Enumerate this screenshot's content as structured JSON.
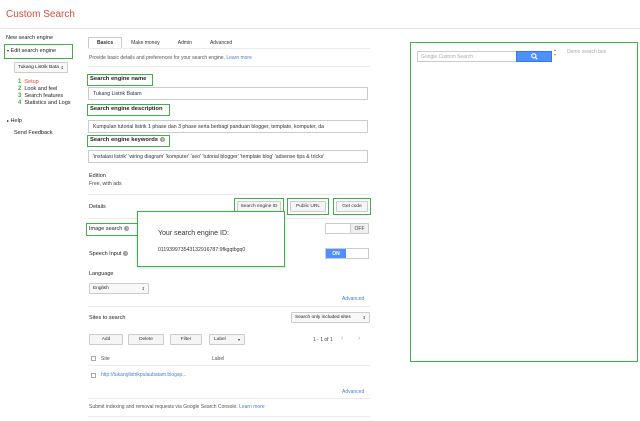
{
  "app": {
    "title": "Custom Search"
  },
  "sidebar": {
    "new_engine": "New search engine",
    "edit_engine": "Edit search engine",
    "engine_select": "Tukang Listrik Bata",
    "steps": [
      {
        "num": "1",
        "label": "Setup"
      },
      {
        "num": "2",
        "label": "Look and feel"
      },
      {
        "num": "3",
        "label": "Search features"
      },
      {
        "num": "4",
        "label": "Statistics and Logs"
      }
    ],
    "help": "Help",
    "feedback": "Send Feedback"
  },
  "tabs": [
    "Basics",
    "Make money",
    "Admin",
    "Advanced"
  ],
  "intro": {
    "text": "Provide basic details and preferences for your search engine.",
    "link": "Learn more"
  },
  "fields": {
    "name_label": "Search engine name",
    "name_value": "Tukang Listrik Batam",
    "desc_label": "Search engine description",
    "desc_value": "Kumpulan tutorial listrik 1 phase dan 3 phase serta berbagi panduan blogger, template, komputer, da",
    "keywords_label": "Search engine keywords",
    "keywords_value": "'instalasi listrik' 'wiring diagram' 'komputer' 'seo' 'tutorial blogger' 'template blog' 'adsense tips & tricks'"
  },
  "edition": {
    "label": "Edition",
    "value": "Free, with ads"
  },
  "details": {
    "label": "Details",
    "engine_id_btn": "Search engine ID",
    "public_url_btn": "Public URL",
    "get_code_btn": "Get code"
  },
  "popup": {
    "title": "Your search engine ID:",
    "id": "011939973543132916787:9fkgqtbgq0"
  },
  "image_search": {
    "label": "Image search",
    "state": "OFF"
  },
  "speech_input": {
    "label": "Speech Input",
    "state": "ON"
  },
  "language": {
    "label": "Language",
    "value": "English"
  },
  "advanced_link": "Advanced",
  "sites": {
    "label": "Sites to search",
    "filter_select": "Search only included sites",
    "add_btn": "Add",
    "delete_btn": "Delete",
    "filter_btn": "Filter",
    "label_btn": "Label",
    "pager": "1 - 1 of 1",
    "col_site": "Site",
    "col_label": "Label",
    "rows": [
      {
        "site": "http://tukanglistrikpulaubatam.blogsp..."
      }
    ],
    "advanced_link": "Advanced"
  },
  "footer": {
    "text": "Submit indexing and removal requests via Google Search Console.",
    "link": "Learn more"
  },
  "demo": {
    "placeholder": "Google Custom Search",
    "label": "Demo search box"
  },
  "colors": {
    "accent_red": "#dd4b39",
    "highlight_green": "#3db046",
    "button_blue": "#4d90fe"
  }
}
